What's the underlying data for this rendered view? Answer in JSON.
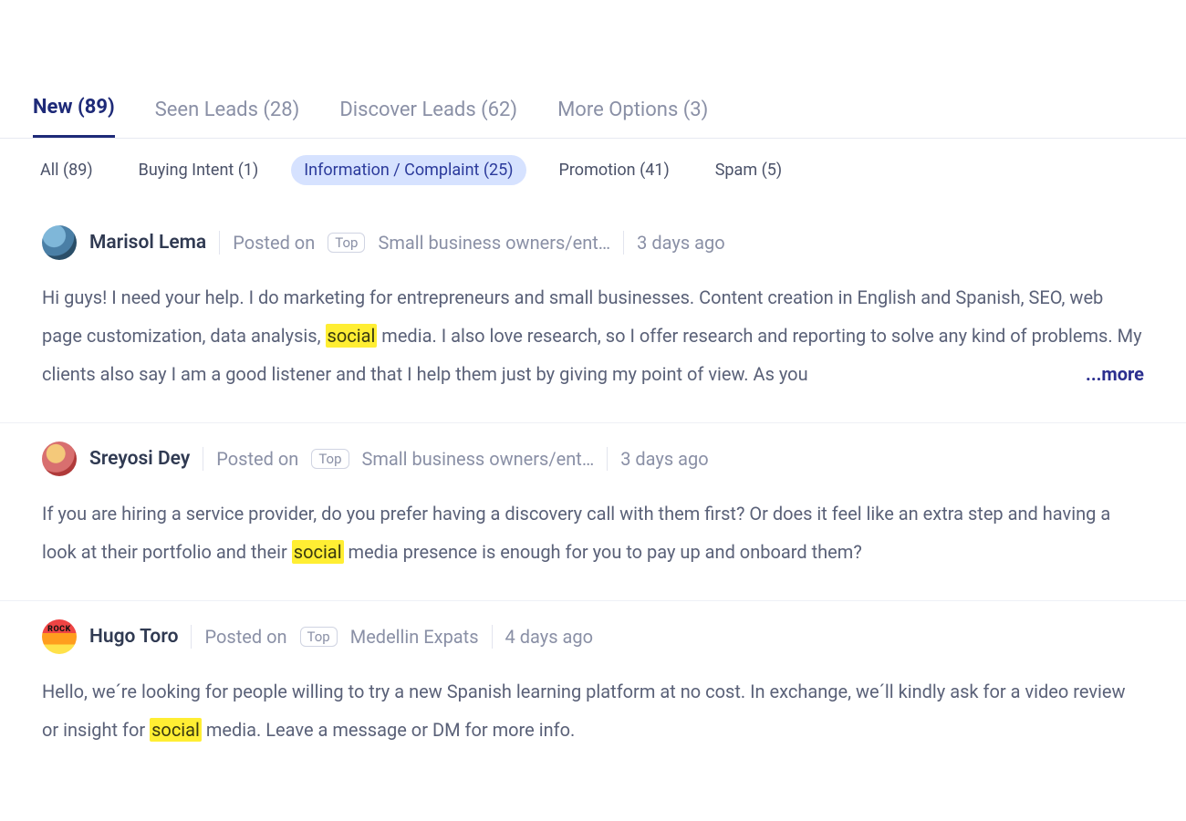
{
  "tabs": [
    {
      "label": "New (89)",
      "active": true
    },
    {
      "label": "Seen Leads (28)",
      "active": false
    },
    {
      "label": "Discover Leads (62)",
      "active": false
    },
    {
      "label": "More Options (3)",
      "active": false
    }
  ],
  "filters": [
    {
      "label": "All (89)",
      "active": false
    },
    {
      "label": "Buying Intent (1)",
      "active": false
    },
    {
      "label": "Information / Complaint (25)",
      "active": true
    },
    {
      "label": "Promotion (41)",
      "active": false
    },
    {
      "label": "Spam (5)",
      "active": false
    }
  ],
  "posted_on_label": "Posted on",
  "top_badge": "Top",
  "more_label": "...more",
  "highlight_term": "social",
  "posts": [
    {
      "author": "Marisol Lema",
      "group": "Small business owners/ent…",
      "when": "3 days ago",
      "avatar_class": "av0",
      "body_pre": "Hi guys! I need your help. I do marketing for entrepreneurs and small businesses. Content creation in English and Spanish, SEO, web page customization, data analysis, ",
      "body_post": " media. I also love research, so I offer research and reporting to solve any kind of problems. My clients also say I am a good listener and that I help them just by giving my point of view. As you",
      "truncated": true
    },
    {
      "author": "Sreyosi Dey",
      "group": "Small business owners/ent…",
      "when": "3 days ago",
      "avatar_class": "av1",
      "body_pre": "If you are hiring a service provider, do you prefer having a discovery call with them first? Or does it feel like an extra step and having a look at their portfolio and their ",
      "body_post": " media presence is enough for you to pay up and onboard them?",
      "truncated": false
    },
    {
      "author": "Hugo Toro",
      "group": "Medellin Expats",
      "when": "4 days ago",
      "avatar_class": "av2",
      "avatar_text": "ROCK",
      "body_pre": "Hello, we´re looking for people willing to try a new Spanish learning platform at no cost. In exchange, we´ll kindly ask for a video review or insight for ",
      "body_post": " media. Leave a message or DM for more info.",
      "truncated": false
    }
  ]
}
